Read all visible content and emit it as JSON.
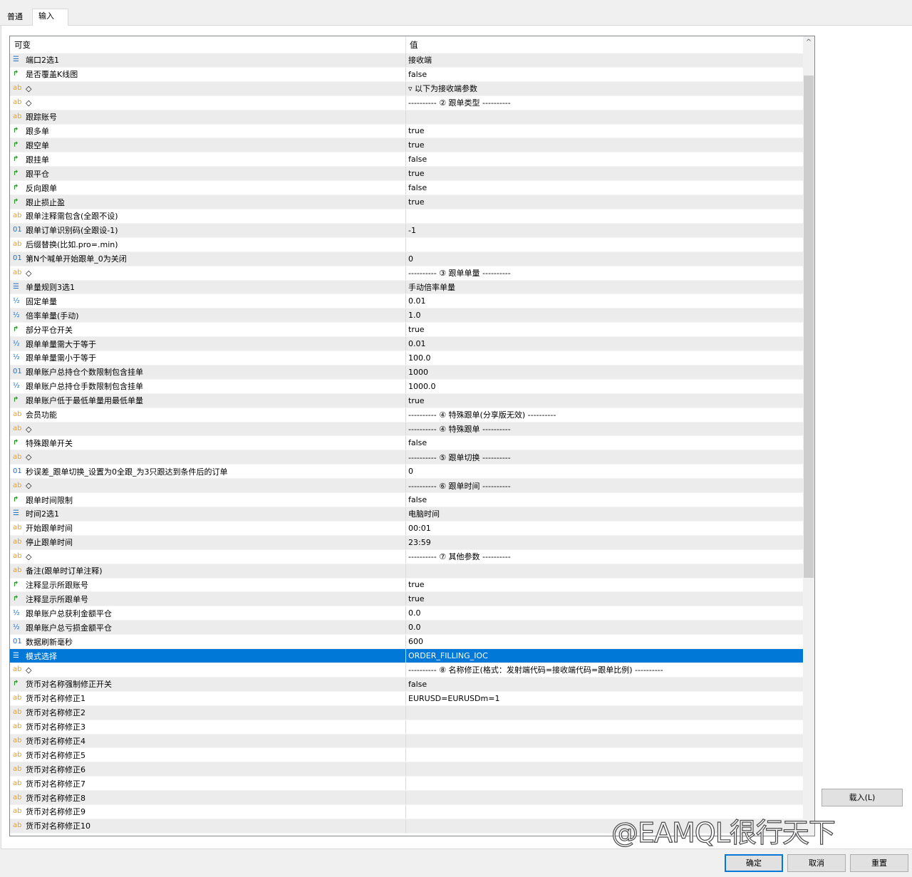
{
  "tabs": [
    "普通",
    "输入"
  ],
  "grid": {
    "col_variable": "可变",
    "col_value": "值",
    "rows": [
      {
        "icon": "enum",
        "name": "端口2选1",
        "value": "接收端"
      },
      {
        "icon": "bool",
        "name": "是否覆盖K线图",
        "value": "false"
      },
      {
        "icon": "ab",
        "name": "◇",
        "value": "▿ 以下为接收端参数"
      },
      {
        "icon": "ab",
        "name": "◇",
        "value": "---------- ② 跟单类型 ----------"
      },
      {
        "icon": "ab",
        "name": "跟踪账号",
        "value": ""
      },
      {
        "icon": "bool",
        "name": "跟多单",
        "value": "true"
      },
      {
        "icon": "bool",
        "name": "跟空单",
        "value": "true"
      },
      {
        "icon": "bool",
        "name": "跟挂单",
        "value": "false"
      },
      {
        "icon": "bool",
        "name": "跟平仓",
        "value": "true"
      },
      {
        "icon": "bool",
        "name": "反向跟单",
        "value": "false"
      },
      {
        "icon": "bool",
        "name": "跟止损止盈",
        "value": "true"
      },
      {
        "icon": "ab",
        "name": "跟单注释需包含(全跟不设)",
        "value": ""
      },
      {
        "icon": "int",
        "name": "跟单订单识别码(全跟设-1)",
        "value": "-1"
      },
      {
        "icon": "ab",
        "name": "后缀替换(比如.pro=.min)",
        "value": ""
      },
      {
        "icon": "int",
        "name": "第N个喊单开始跟单_0为关闭",
        "value": "0"
      },
      {
        "icon": "ab",
        "name": "◇",
        "value": "---------- ③ 跟单单量 ----------"
      },
      {
        "icon": "enum",
        "name": "单量规则3选1",
        "value": "手动倍率单量"
      },
      {
        "icon": "frac",
        "name": "固定单量",
        "value": "0.01"
      },
      {
        "icon": "frac",
        "name": "倍率单量(手动)",
        "value": "1.0"
      },
      {
        "icon": "bool",
        "name": "部分平仓开关",
        "value": "true"
      },
      {
        "icon": "frac",
        "name": "跟单单量需大于等于",
        "value": "0.01"
      },
      {
        "icon": "frac",
        "name": "跟单单量需小于等于",
        "value": "100.0"
      },
      {
        "icon": "int",
        "name": "跟单账户总持仓个数限制包含挂单",
        "value": "1000"
      },
      {
        "icon": "frac",
        "name": "跟单账户总持仓手数限制包含挂单",
        "value": "1000.0"
      },
      {
        "icon": "bool",
        "name": "跟单账户低于最低单量用最低单量",
        "value": "true"
      },
      {
        "icon": "ab",
        "name": "会员功能",
        "value": "---------- ④ 特殊跟单(分享版无效) ----------"
      },
      {
        "icon": "ab",
        "name": "◇",
        "value": "---------- ④ 特殊跟单 ----------"
      },
      {
        "icon": "bool",
        "name": "特殊跟单开关",
        "value": "false"
      },
      {
        "icon": "ab",
        "name": "◇",
        "value": "---------- ⑤ 跟单切换 ----------"
      },
      {
        "icon": "int",
        "name": "秒误差_跟单切换_设置为0全跟_为3只跟达到条件后的订单",
        "value": "0"
      },
      {
        "icon": "ab",
        "name": "◇",
        "value": "---------- ⑥ 跟单时间 ----------"
      },
      {
        "icon": "bool",
        "name": "跟单时间限制",
        "value": "false"
      },
      {
        "icon": "enum",
        "name": "时间2选1",
        "value": "电脑时间"
      },
      {
        "icon": "ab",
        "name": "开始跟单时间",
        "value": "00:01"
      },
      {
        "icon": "ab",
        "name": "停止跟单时间",
        "value": "23:59"
      },
      {
        "icon": "ab",
        "name": "◇",
        "value": "---------- ⑦ 其他参数 ----------"
      },
      {
        "icon": "ab",
        "name": "备注(跟单时订单注释)",
        "value": ""
      },
      {
        "icon": "bool",
        "name": "注释显示所跟账号",
        "value": "true"
      },
      {
        "icon": "bool",
        "name": "注释显示所跟单号",
        "value": "true"
      },
      {
        "icon": "frac",
        "name": "跟单账户总获利金额平仓",
        "value": "0.0"
      },
      {
        "icon": "frac",
        "name": "跟单账户总亏损金额平仓",
        "value": "0.0"
      },
      {
        "icon": "int",
        "name": "数据刷新毫秒",
        "value": "600"
      },
      {
        "icon": "enum",
        "name": "模式选择",
        "value": "ORDER_FILLING_IOC",
        "selected": true
      },
      {
        "icon": "ab",
        "name": "◇",
        "value": "---------- ⑧ 名称修正(格式：发射端代码=接收端代码=跟单比例) ----------"
      },
      {
        "icon": "bool",
        "name": "货币对名称强制修正开关",
        "value": "false"
      },
      {
        "icon": "ab",
        "name": "货币对名称修正1",
        "value": "EURUSD=EURUSDm=1"
      },
      {
        "icon": "ab",
        "name": "货币对名称修正2",
        "value": ""
      },
      {
        "icon": "ab",
        "name": "货币对名称修正3",
        "value": ""
      },
      {
        "icon": "ab",
        "name": "货币对名称修正4",
        "value": ""
      },
      {
        "icon": "ab",
        "name": "货币对名称修正5",
        "value": ""
      },
      {
        "icon": "ab",
        "name": "货币对名称修正6",
        "value": ""
      },
      {
        "icon": "ab",
        "name": "货币对名称修正7",
        "value": ""
      },
      {
        "icon": "ab",
        "name": "货币对名称修正8",
        "value": ""
      },
      {
        "icon": "ab",
        "name": "货币对名称修正9",
        "value": ""
      },
      {
        "icon": "ab",
        "name": "货币对名称修正10",
        "value": ""
      }
    ]
  },
  "icons": {
    "ab": "ab",
    "bool": "↱",
    "int": "01",
    "frac": "½",
    "enum": "☰"
  },
  "buttons": {
    "load": "载入(L)",
    "ok": "确定",
    "cancel": "取消",
    "reset": "重置"
  },
  "watermark": "@EAMQL很行天下"
}
